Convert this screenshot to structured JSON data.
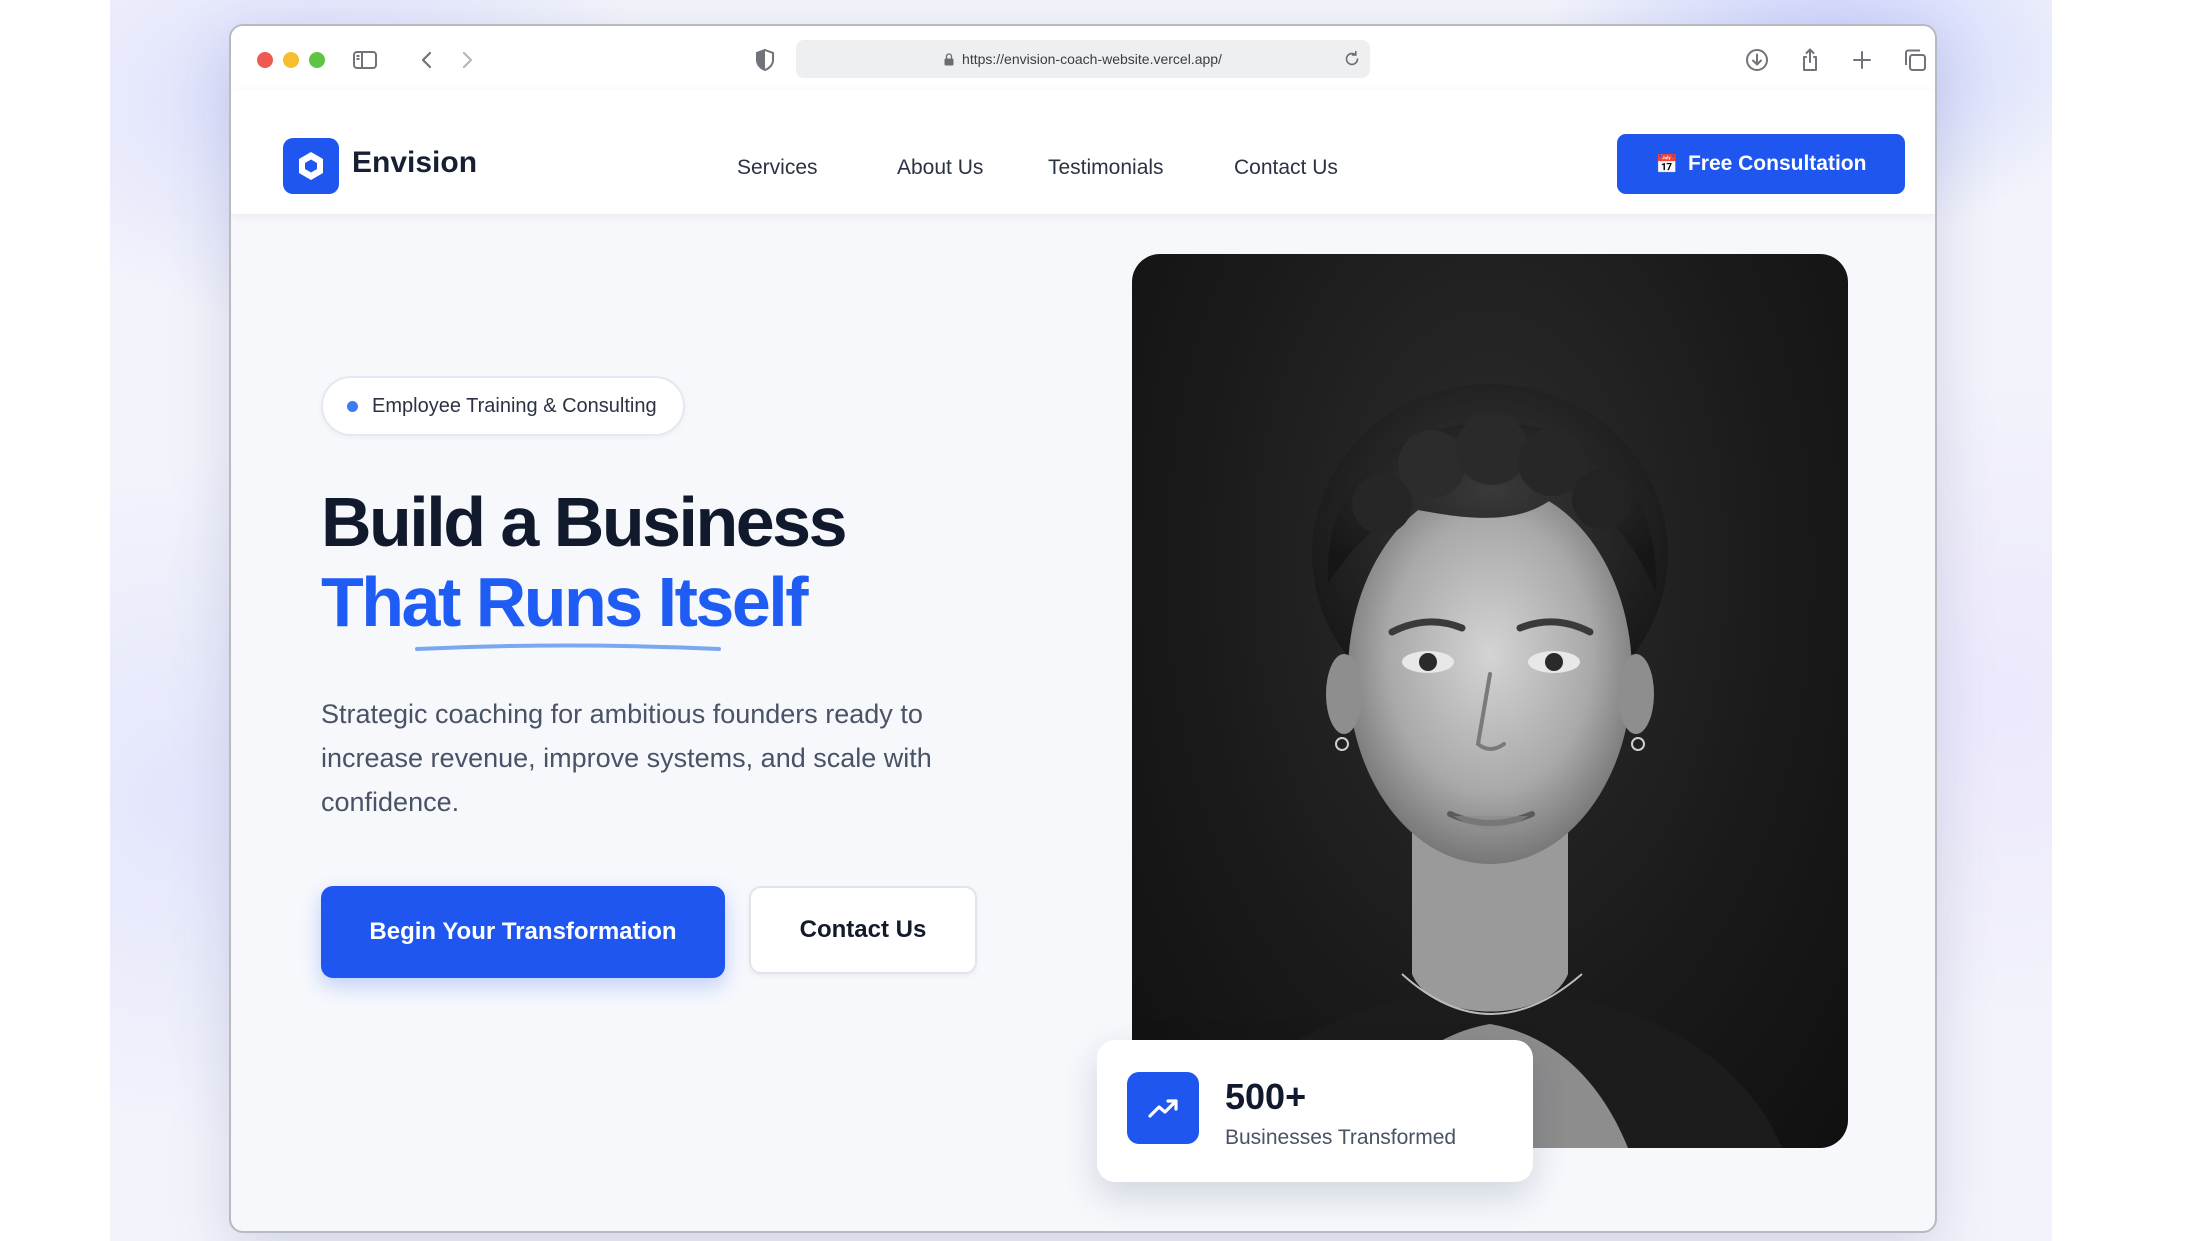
{
  "browser": {
    "url": "https://envision-coach-website.vercel.app/"
  },
  "brand": {
    "name": "Envision",
    "accent_color": "#1f56f0"
  },
  "nav": {
    "links": [
      "Services",
      "About Us",
      "Testimonials",
      "Contact Us"
    ],
    "cta_icon": "📅",
    "cta_label": "Free Consultation"
  },
  "hero": {
    "badge": "Employee Training & Consulting",
    "headline_line1": "Build a Business",
    "headline_line2": "That Runs Itself",
    "subtext": "Strategic coaching for ambitious founders ready to increase revenue, improve systems, and scale with confidence.",
    "primary_button": "Begin Your Transformation",
    "secondary_button": "Contact Us"
  },
  "stat": {
    "icon": "trending-up-icon",
    "value": "500+",
    "label": "Businesses Transformed"
  }
}
